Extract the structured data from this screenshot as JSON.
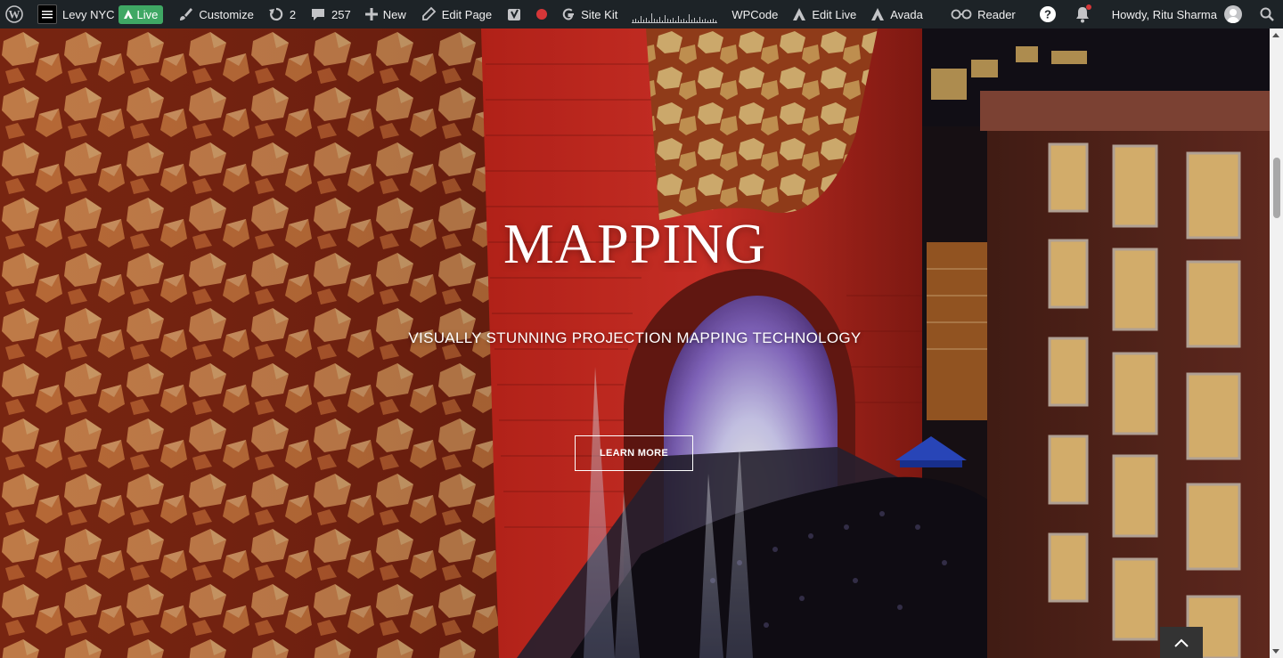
{
  "adminbar": {
    "site_name": "Levy NYC",
    "live_label": "Live",
    "customize_label": "Customize",
    "updates_count": "2",
    "comments_count": "257",
    "new_label": "New",
    "edit_page_label": "Edit Page",
    "sitekit_label": "Site Kit",
    "wpcode_label": "WPCode",
    "edit_live_label": "Edit Live",
    "avada_label": "Avada",
    "reader_label": "Reader",
    "howdy_label": "Howdy, Ritu Sharma"
  },
  "hero": {
    "title": "MAPPING",
    "subtitle": "VISUALLY STUNNING PROJECTION MAPPING TECHNOLOGY",
    "button_label": "LEARN MORE"
  },
  "colors": {
    "adminbar_bg": "#1d2327",
    "live_green": "#3fa864",
    "record_red": "#d63638"
  }
}
